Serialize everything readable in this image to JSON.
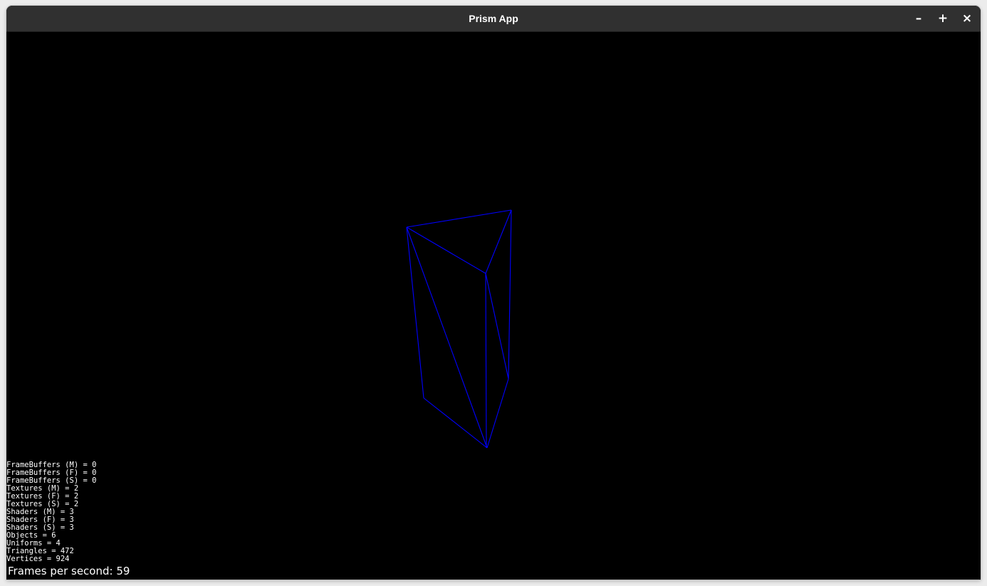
{
  "window": {
    "title": "Prism App",
    "controls": {
      "minimize": "–",
      "maximize": "+",
      "close": "×"
    }
  },
  "viewport": {
    "background": "#000000",
    "mesh_color": "#0000ff"
  },
  "stats": [
    "FrameBuffers (M) = 0",
    "FrameBuffers (F) = 0",
    "FrameBuffers (S) = 0",
    "Textures (M) = 2",
    "Textures (F) = 2",
    "Textures (S) = 2",
    "Shaders (M) = 3",
    "Shaders (F) = 3",
    "Shaders (S) = 3",
    "Objects = 6",
    "Uniforms = 4",
    "Triangles = 472",
    "Vertices = 924"
  ],
  "fps": "Frames per second: 59"
}
